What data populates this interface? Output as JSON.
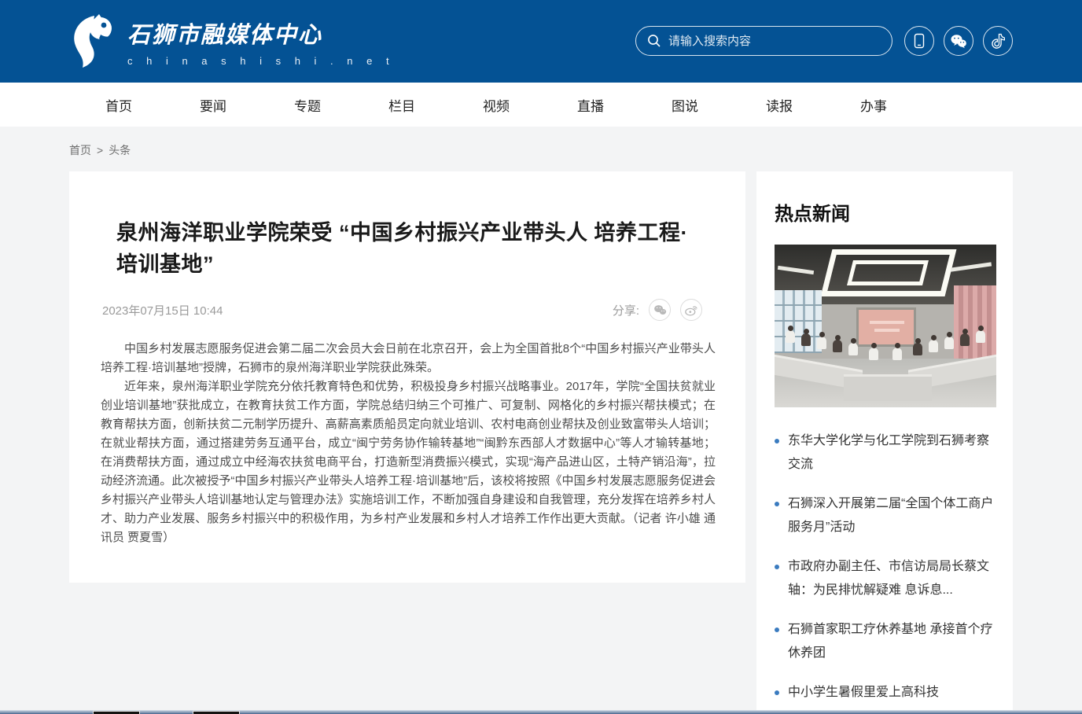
{
  "header": {
    "logo_title": "石狮市融媒体中心",
    "logo_subtitle": "c h i n a s h i s h i . n e t",
    "search_placeholder": "请输入搜索内容"
  },
  "nav": {
    "items": [
      "首页",
      "要闻",
      "专题",
      "栏目",
      "视频",
      "直播",
      "图说",
      "读报",
      "办事"
    ]
  },
  "breadcrumb": {
    "home": "首页",
    "separator": ">",
    "current": "头条"
  },
  "article": {
    "title": "泉州海洋职业学院荣受 “中国乡村振兴产业带头人 培养工程·培训基地”",
    "date": "2023年07月15日 10:44",
    "share_label": "分享:",
    "paragraphs": [
      "中国乡村发展志愿服务促进会第二届二次会员大会日前在北京召开，会上为全国首批8个“中国乡村振兴产业带头人培养工程·培训基地”授牌，石狮市的泉州海洋职业学院获此殊荣。",
      "近年来，泉州海洋职业学院充分依托教育特色和优势，积极投身乡村振兴战略事业。2017年，学院“全国扶贫就业创业培训基地”获批成立，在教育扶贫工作方面，学院总结归纳三个可推广、可复制、网格化的乡村振兴帮扶模式；在教育帮扶方面，创新扶贫二元制学历提升、高薪高素质船员定向就业培训、农村电商创业帮扶及创业致富带头人培训；在就业帮扶方面，通过搭建劳务互通平台，成立“闽宁劳务协作输转基地”“闽黔东西部人才数据中心”等人才输转基地；在消费帮扶方面，通过成立中经海农扶贫电商平台，打造新型消费振兴模式，实现“海产品进山区，土特产销沿海”，拉动经济流通。此次被授予“中国乡村振兴产业带头人培养工程·培训基地”后，该校将按照《中国乡村发展志愿服务促进会乡村振兴产业带头人培训基地认定与管理办法》实施培训工作，不断加强自身建设和自我管理，充分发挥在培养乡村人才、助力产业发展、服务乡村振兴中的积极作用，为乡村产业发展和乡村人才培养工作作出更大贡献。（记者 许小雄 通讯员 贾夏雪）"
    ]
  },
  "sidebar": {
    "title": "热点新闻",
    "items": [
      "东华大学化学与化工学院到石狮考察交流",
      "石狮深入开展第二届“全国个体工商户服务月”活动",
      "市政府办副主任、市信访局局长蔡文轴：为民排忧解疑难 息诉息...",
      "石狮首家职工疗休养基地 承接首个疗休养团",
      "中小学生暑假里爱上高科技"
    ]
  },
  "colors": {
    "header_blue": "#045294",
    "bullet_blue": "#3a7bbf",
    "page_bg": "#f3f4f5",
    "title_text": "#1a1a1a",
    "body_text": "#4d4d4d",
    "muted_text": "#9a9a9a"
  }
}
